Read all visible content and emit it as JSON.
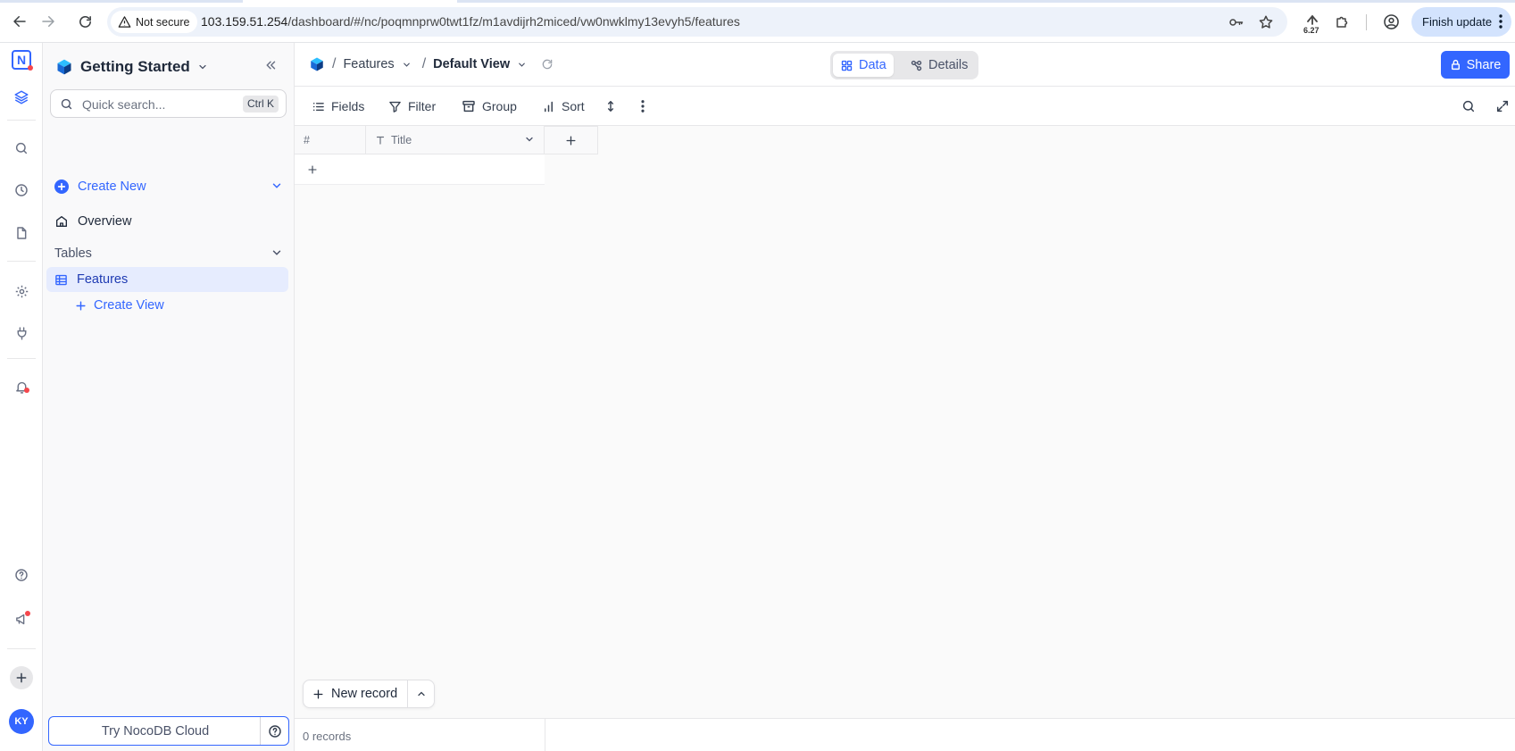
{
  "browser": {
    "security_label": "Not secure",
    "url_host": "103.159.51.254",
    "url_path": "/dashboard/#/nc/poqmnprw0twt1fz/m1avdijrh2miced/vw0nwklmy13evyh5/features",
    "extension_badge": "6.27",
    "finish_update_label": "Finish update"
  },
  "rail": {
    "avatar_initials": "KY"
  },
  "sidebar": {
    "base_name": "Getting Started",
    "search_placeholder": "Quick search...",
    "search_shortcut": "Ctrl K",
    "create_new_label": "Create New",
    "overview_label": "Overview",
    "tables_heading": "Tables",
    "table_name": "Features",
    "create_view_label": "Create View",
    "try_cloud_label": "Try NocoDB Cloud"
  },
  "topbar": {
    "breadcrumb_table": "Features",
    "breadcrumb_view": "Default View",
    "tab_data": "Data",
    "tab_details": "Details",
    "share_label": "Share"
  },
  "toolbar": {
    "fields_label": "Fields",
    "filter_label": "Filter",
    "group_label": "Group",
    "sort_label": "Sort"
  },
  "grid": {
    "row_number_header": "#",
    "title_header": "Title",
    "new_record_label": "New record"
  },
  "footer": {
    "record_count": "0 records"
  },
  "colors": {
    "accent": "#3366ff",
    "sidebar_bg": "#f9f9fa",
    "selected_row_bg": "#e6ecfe",
    "notification_dot": "#f5474c"
  }
}
